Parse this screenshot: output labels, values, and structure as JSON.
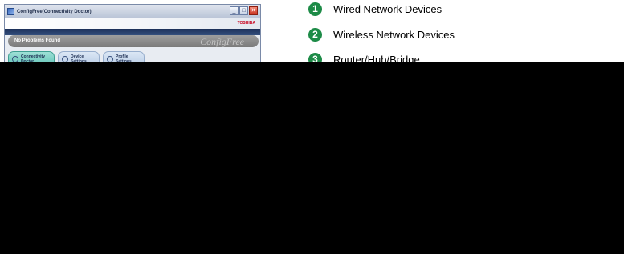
{
  "window": {
    "title": "ConfigFree(Connectivity Doctor)",
    "brand": "TOSHIBA",
    "icon": "app-icon",
    "controls": [
      {
        "name": "minimize-button",
        "glyph": "_"
      },
      {
        "name": "maximize-button",
        "glyph": "□"
      },
      {
        "name": "close-button",
        "glyph": "✕"
      }
    ]
  },
  "status": {
    "message": "No Problems Found",
    "logo": "ConfigFree"
  },
  "tabs": [
    {
      "line1": "Connectivity",
      "line2": "Doctor",
      "icon": "stethoscope-icon",
      "active": true
    },
    {
      "line1": "Device",
      "line2": "Settings",
      "icon": "device-icon",
      "active": false
    },
    {
      "line1": "Profile",
      "line2": "Settings",
      "icon": "profile-icon",
      "active": false
    }
  ],
  "legend": [
    {
      "number": "1",
      "label": "Wired Network Devices"
    },
    {
      "number": "2",
      "label": "Wireless Network Devices"
    },
    {
      "number": "3",
      "label": "Router/Hub/Bridge"
    }
  ],
  "colors": {
    "legend_marker": "#1d8b47",
    "active_tab": "#5fc2b5",
    "brand": "#c8001c",
    "status_bar": "#8c8c8c"
  }
}
